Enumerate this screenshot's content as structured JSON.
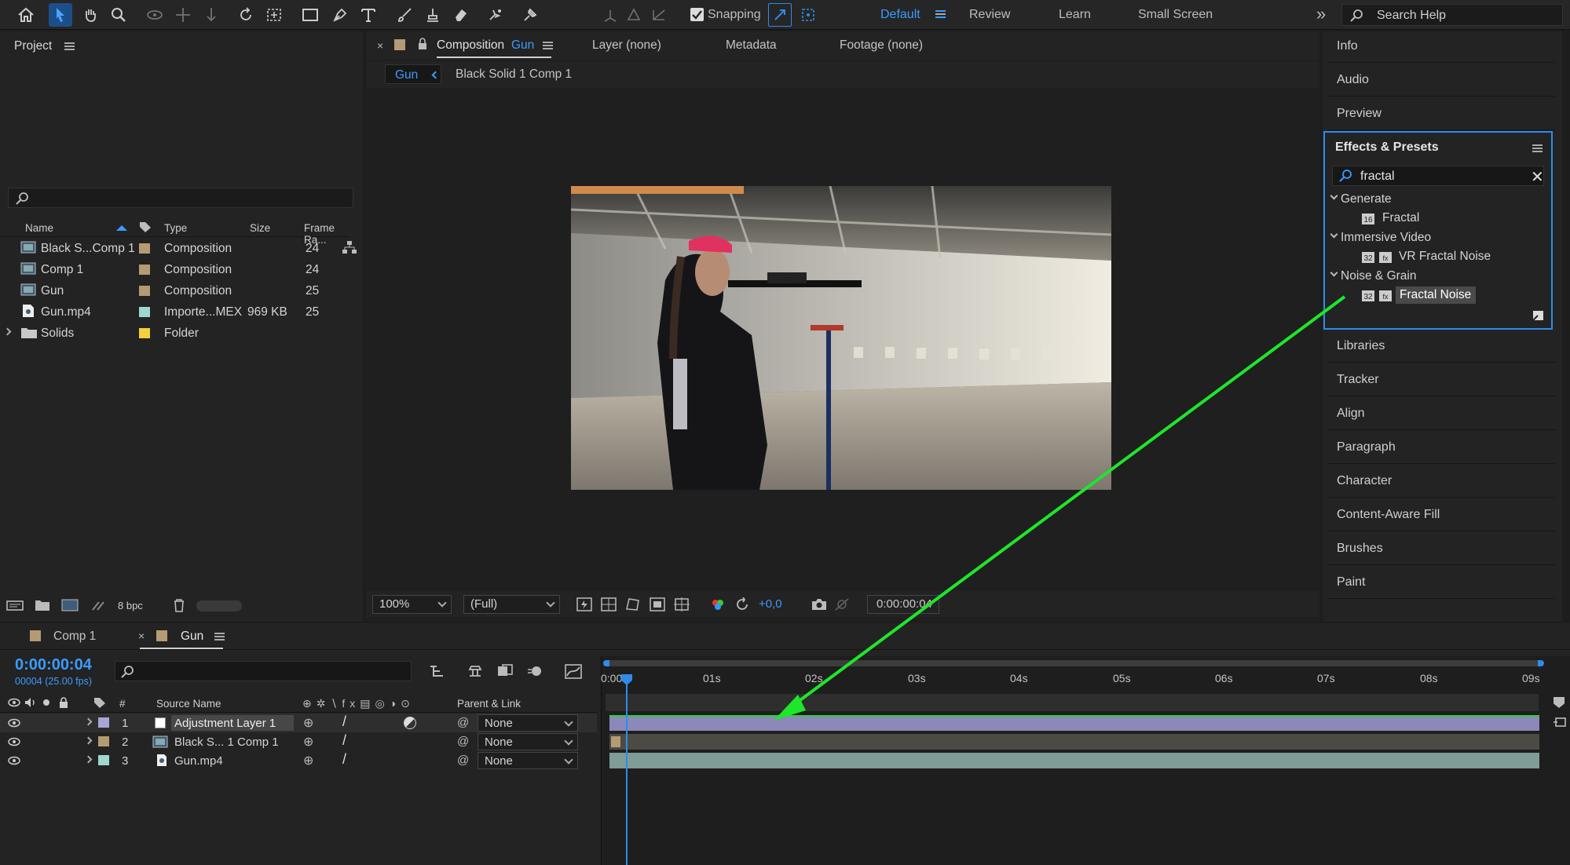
{
  "toolbar": {
    "snapping_label": "Snapping",
    "workspaces": [
      "Default",
      "Review",
      "Learn",
      "Small Screen"
    ],
    "search_placeholder": "Search Help",
    "more_label": "»"
  },
  "project": {
    "title": "Project",
    "columns": [
      "Name",
      "Type",
      "Size",
      "Frame Ra..."
    ],
    "rows": [
      {
        "name": "Black S...Comp 1",
        "type": "Composition",
        "size": "",
        "fps": "24",
        "color": "#b59b73",
        "icon": "composition-icon"
      },
      {
        "name": "Comp 1",
        "type": "Composition",
        "size": "",
        "fps": "24",
        "color": "#b59b73",
        "icon": "composition-icon"
      },
      {
        "name": "Gun",
        "type": "Composition",
        "size": "",
        "fps": "25",
        "color": "#b59b73",
        "icon": "composition-icon"
      },
      {
        "name": "Gun.mp4",
        "type": "Importe...MEX",
        "size": "969 KB",
        "fps": "25",
        "color": "#9fd6d0",
        "icon": "footage-icon"
      },
      {
        "name": "Solids",
        "type": "Folder",
        "size": "",
        "fps": "",
        "color": "#f3d03e",
        "icon": "folder-icon"
      }
    ],
    "bpc_label": "8 bpc"
  },
  "viewer": {
    "tabs": [
      "Composition",
      "Gun",
      "Layer (none)",
      "Metadata",
      "Footage (none)"
    ],
    "breadcrumb": [
      "Gun",
      "Black Solid 1 Comp 1"
    ],
    "zoom": "100%",
    "resolution": "(Full)",
    "exposure": "+0,0",
    "timecode": "0:00:00:04"
  },
  "right_panel": {
    "top_items": [
      "Info",
      "Audio",
      "Preview"
    ],
    "effects": {
      "title": "Effects & Presets",
      "search_value": "fractal",
      "groups": [
        {
          "name": "Generate",
          "items": [
            {
              "label": "Fractal",
              "bits": "16"
            }
          ]
        },
        {
          "name": "Immersive Video",
          "items": [
            {
              "label": "VR Fractal Noise",
              "bits": "32"
            }
          ]
        },
        {
          "name": "Noise & Grain",
          "items": [
            {
              "label": "Fractal Noise",
              "bits": "32",
              "selected": true
            }
          ]
        }
      ]
    },
    "bottom_items": [
      "Libraries",
      "Tracker",
      "Align",
      "Paragraph",
      "Character",
      "Content-Aware Fill",
      "Brushes",
      "Paint"
    ]
  },
  "timeline": {
    "tabs": [
      "Comp 1",
      "Gun"
    ],
    "timecode": "0:00:00:04",
    "frame_info": "00004 (25.00 fps)",
    "col_source": "Source Name",
    "col_parent": "Parent & Link",
    "col_num": "#",
    "ruler": [
      "0:00",
      "01s",
      "02s",
      "03s",
      "04s",
      "05s",
      "06s",
      "07s",
      "08s",
      "09s"
    ],
    "layers": [
      {
        "num": "1",
        "name": "Adjustment Layer 1",
        "parent": "None",
        "color": "#a9a4d8"
      },
      {
        "num": "2",
        "name": "Black S... 1 Comp 1",
        "parent": "None",
        "color": "#b59b73"
      },
      {
        "num": "3",
        "name": "Gun.mp4",
        "parent": "None",
        "color": "#9fd6d0"
      }
    ]
  },
  "colors": {
    "accent": "#2d8ceb",
    "annotation_arrow": "#1ee62b"
  }
}
